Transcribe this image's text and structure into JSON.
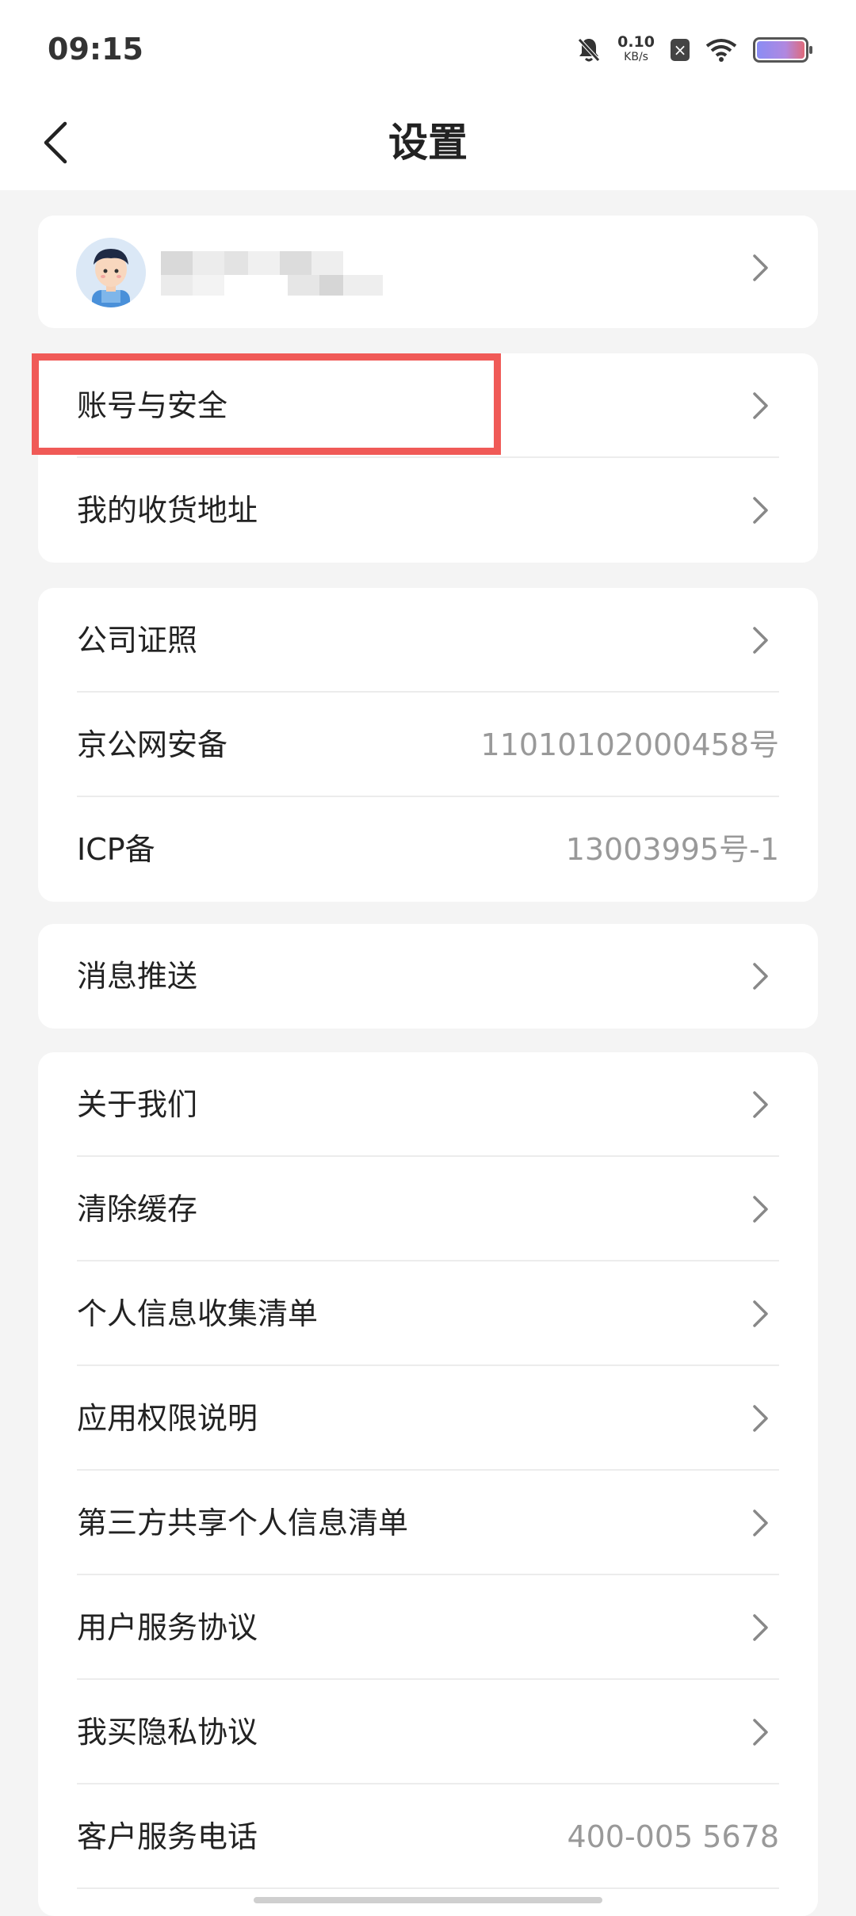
{
  "status_bar": {
    "time": "09:15",
    "net_speed_value": "0.10",
    "net_speed_unit": "KB/s",
    "icons": [
      "bell-muted-icon",
      "sim-disabled-icon",
      "wifi-icon",
      "battery-icon"
    ]
  },
  "nav": {
    "title": "设置",
    "back_icon": "chevron-left-icon"
  },
  "profile": {
    "avatar": "avatar-cartoon-boy"
  },
  "account_card": {
    "items": [
      {
        "label": "账号与安全",
        "highlighted": true
      },
      {
        "label": "我的收货地址"
      }
    ]
  },
  "license_card": {
    "items": [
      {
        "label": "公司证照"
      },
      {
        "label": "京公网安备",
        "value": "11010102000458号"
      },
      {
        "label": "ICP备",
        "value": "13003995号-1"
      }
    ]
  },
  "push_card": {
    "items": [
      {
        "label": "消息推送"
      }
    ]
  },
  "about_card": {
    "items": [
      {
        "label": "关于我们"
      },
      {
        "label": "清除缓存"
      },
      {
        "label": "个人信息收集清单"
      },
      {
        "label": "应用权限说明"
      },
      {
        "label": "第三方共享个人信息清单"
      },
      {
        "label": "用户服务协议"
      },
      {
        "label": "我买隐私协议"
      },
      {
        "label": "客户服务电话",
        "value": "400-005 5678"
      }
    ]
  },
  "colors": {
    "highlight": "#f05a57",
    "background": "#f4f4f4",
    "card": "#ffffff",
    "secondary_text": "#999999"
  }
}
